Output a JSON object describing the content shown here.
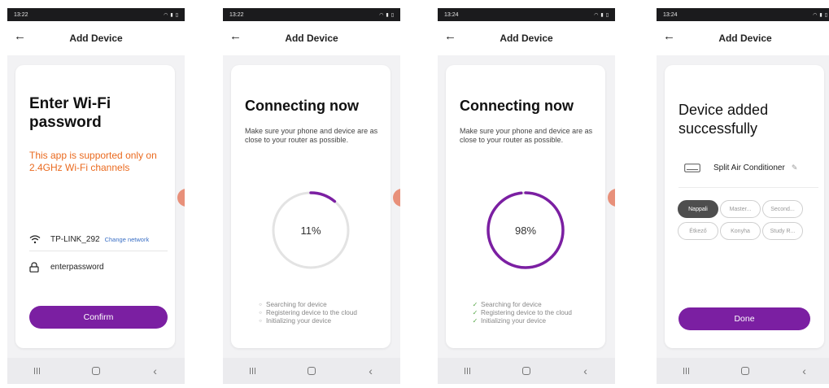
{
  "screens": [
    {
      "status_time": "13:22",
      "appbar_title": "Add Device",
      "heading": "Enter Wi-Fi password",
      "warning": "This app is supported only on 2.4GHz Wi-Fi channels",
      "ssid": "TP-LINK_292",
      "change_network": "Change network",
      "password": "enterpassword",
      "confirm_label": "Confirm"
    },
    {
      "status_time": "13:22",
      "appbar_title": "Add Device",
      "heading": "Connecting now",
      "description": "Make sure your phone and device are as close to your router as possible.",
      "progress_label": "11%",
      "progress_value": 0.11,
      "steps": [
        {
          "label": "Searching for device",
          "done": false
        },
        {
          "label": "Registering device to the cloud",
          "done": false
        },
        {
          "label": "Initializing your device",
          "done": false
        }
      ]
    },
    {
      "status_time": "13:24",
      "appbar_title": "Add Device",
      "heading": "Connecting now",
      "description": "Make sure your phone and device are as close to your router as possible.",
      "progress_label": "98%",
      "progress_value": 0.98,
      "steps": [
        {
          "label": "Searching for device",
          "done": true
        },
        {
          "label": "Registering device to the cloud",
          "done": true
        },
        {
          "label": "Initializing your device",
          "done": true
        }
      ]
    },
    {
      "status_time": "13:24",
      "appbar_title": "Add Device",
      "heading": "Device added successfully",
      "device_name": "Split Air Conditioner",
      "rooms": [
        {
          "label": "Nappali",
          "active": true
        },
        {
          "label": "Master...",
          "active": false
        },
        {
          "label": "Second...",
          "active": false
        },
        {
          "label": "Étkező",
          "active": false
        },
        {
          "label": "Konyha",
          "active": false
        },
        {
          "label": "Study R...",
          "active": false
        }
      ],
      "done_label": "Done"
    }
  ],
  "colors": {
    "accent": "#7b1fa2",
    "warning": "#ea6a1f",
    "link": "#3a6fc5",
    "success": "#58a84a",
    "ring_track": "#e3e3e3"
  }
}
